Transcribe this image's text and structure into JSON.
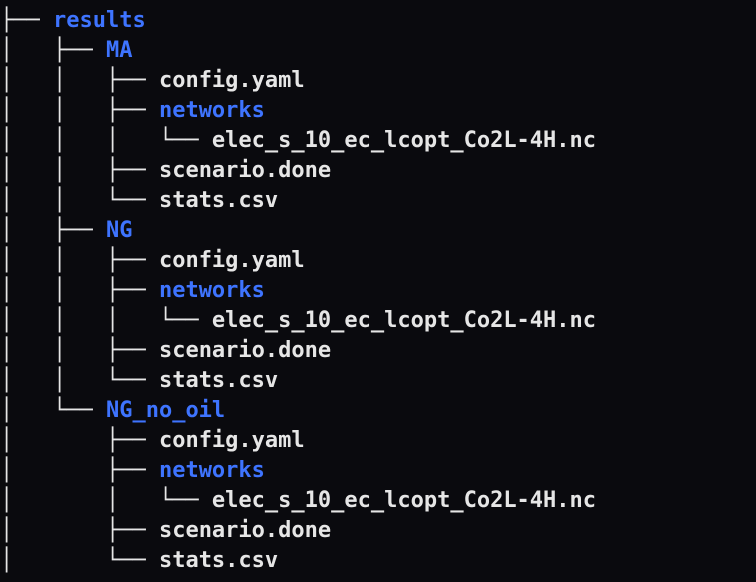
{
  "tree": {
    "root": "results",
    "scenarios": [
      {
        "name": "MA",
        "files_before_networks": [
          "config.yaml"
        ],
        "networks": {
          "name": "networks",
          "files": [
            "elec_s_10_ec_lcopt_Co2L-4H.nc"
          ]
        },
        "files_after_networks": [
          "scenario.done",
          "stats.csv"
        ],
        "is_last": false
      },
      {
        "name": "NG",
        "files_before_networks": [
          "config.yaml"
        ],
        "networks": {
          "name": "networks",
          "files": [
            "elec_s_10_ec_lcopt_Co2L-4H.nc"
          ]
        },
        "files_after_networks": [
          "scenario.done",
          "stats.csv"
        ],
        "is_last": false
      },
      {
        "name": "NG_no_oil",
        "files_before_networks": [
          "config.yaml"
        ],
        "networks": {
          "name": "networks",
          "files": [
            "elec_s_10_ec_lcopt_Co2L-4H.nc"
          ]
        },
        "files_after_networks": [
          "scenario.done",
          "stats.csv"
        ],
        "is_last": true
      }
    ]
  },
  "glyphs": {
    "vert": "│   ",
    "tee": "├── ",
    "ell": "└── ",
    "blank": "    "
  }
}
